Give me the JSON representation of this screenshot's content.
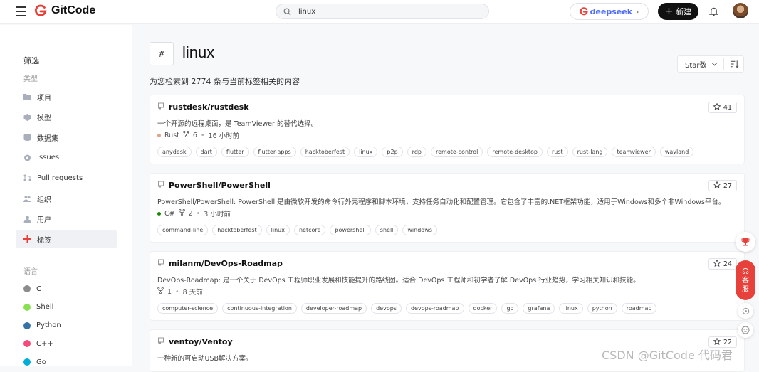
{
  "header": {
    "logo_text": "GitCode",
    "search_value": "linux",
    "deepseek_label": "deepseek",
    "new_label": "新建",
    "brand_color": "#e6413a",
    "deepseek_color": "#4f6df5"
  },
  "sidebar": {
    "title": "筛选",
    "type_label": "类型",
    "types": [
      {
        "label": "项目",
        "icon": "folder-icon"
      },
      {
        "label": "模型",
        "icon": "cube-icon"
      },
      {
        "label": "数据集",
        "icon": "database-icon"
      },
      {
        "label": "Issues",
        "icon": "issue-icon"
      },
      {
        "label": "Pull requests",
        "icon": "pull-request-icon"
      },
      {
        "label": "组织",
        "icon": "organization-icon"
      },
      {
        "label": "用户",
        "icon": "user-icon"
      },
      {
        "label": "标签",
        "icon": "tag-icon",
        "active": true
      }
    ],
    "lang_label": "语言",
    "languages": [
      {
        "label": "C",
        "color": "#8c8c8c"
      },
      {
        "label": "Shell",
        "color": "#89e051"
      },
      {
        "label": "Python",
        "color": "#3572a5"
      },
      {
        "label": "C++",
        "color": "#f34b7d"
      },
      {
        "label": "Go",
        "color": "#00add8"
      }
    ]
  },
  "main": {
    "hash_symbol": "#",
    "tag_title": "linux",
    "sort_label": "Star数",
    "result_count": "为您检索到 2774 条与当前标签相关的内容"
  },
  "cards": [
    {
      "name": "rustdesk/rustdesk",
      "desc": "一个开源的远程桌面，是 TeamViewer 的替代选择。",
      "lang": "Rust",
      "lang_color": "#dea584",
      "forks": "6",
      "time": "16 小时前",
      "stars": "41",
      "tags": [
        "anydesk",
        "dart",
        "flutter",
        "flutter-apps",
        "hacktoberfest",
        "linux",
        "p2p",
        "rdp",
        "remote-control",
        "remote-desktop",
        "rust",
        "rust-lang",
        "teamviewer",
        "wayland"
      ]
    },
    {
      "name": "PowerShell/PowerShell",
      "desc": "PowerShell/PowerShell: PowerShell 是由微软开发的命令行外壳程序和脚本环境，支持任务自动化和配置管理。它包含了丰富的.NET框架功能，适用于Windows和多个非Windows平台。",
      "lang": "C#",
      "lang_color": "#178600",
      "forks": "2",
      "time": "3 小时前",
      "stars": "27",
      "tags": [
        "command-line",
        "hacktoberfest",
        "linux",
        "netcore",
        "powershell",
        "shell",
        "windows"
      ]
    },
    {
      "name": "milanm/DevOps-Roadmap",
      "desc": "DevOps-Roadmap: 是一个关于 DevOps 工程师职业发展和技能提升的路线图。适合 DevOps 工程师和初学者了解 DevOps 行业趋势，学习相关知识和技能。",
      "lang": "",
      "lang_color": "",
      "forks": "1",
      "time": "8 天前",
      "stars": "24",
      "tags": [
        "computer-science",
        "continuous-integration",
        "developer-roadmap",
        "devops",
        "devops-roadmap",
        "docker",
        "go",
        "grafana",
        "linux",
        "python",
        "roadmap"
      ]
    },
    {
      "name": "ventoy/Ventoy",
      "desc": "一种新的可启动USB解决方案。",
      "lang": "",
      "lang_color": "",
      "forks": "",
      "time": "",
      "stars": "22",
      "tags": []
    }
  ],
  "float": {
    "kefu_line1": "客",
    "kefu_line2": "服"
  },
  "watermark": "CSDN @GitCode 代码君"
}
